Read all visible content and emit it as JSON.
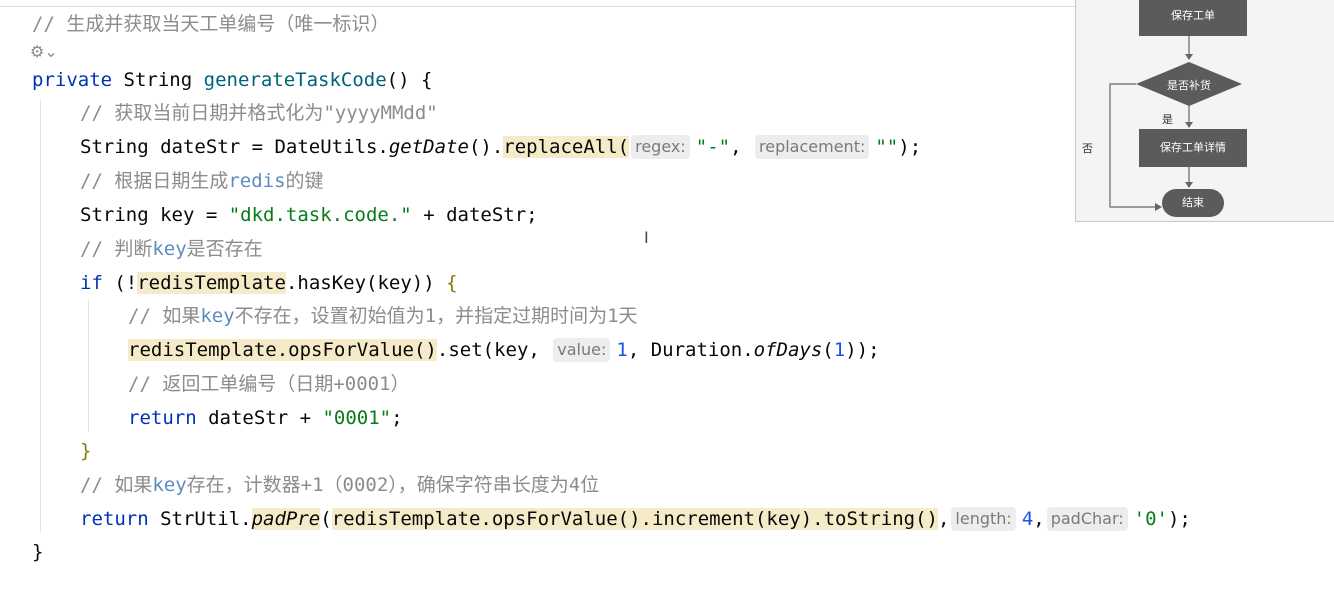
{
  "editor": {
    "comment_title": "// 生成并获取当天工单编号（唯一标识）",
    "gear_label": "⚙⌄",
    "sig": {
      "mod": "private",
      "type": "String",
      "name": "generateTaskCode",
      "rest": "() {"
    },
    "l1_comment": "// 获取当前日期并格式化为\"yyyyMMdd\"",
    "l2": {
      "a": "String dateStr = DateUtils.",
      "getDate": "getDate",
      "b": "().",
      "replaceAll": "replaceAll(",
      "hint_regex": "regex:",
      "s1": "\"-\"",
      "comma": ",",
      "hint_replacement": "replacement:",
      "s2": "\"\"",
      "end": ");"
    },
    "l3_comment_a": "// 根据日期生成",
    "l3_comment_kw": "redis",
    "l3_comment_b": "的键",
    "l4": {
      "a": "String key = ",
      "s": "\"dkd.task.code.\"",
      "b": " + dateStr;"
    },
    "l5_comment_a": "// 判断",
    "l5_comment_kw": "key",
    "l5_comment_b": "是否存在",
    "l6": {
      "if": "if",
      "a": " (!",
      "obj": "redisTemplate",
      "b": ".hasKey(key)",
      "c": ") ",
      "brace": "{"
    },
    "l7_comment_a": "// 如果",
    "l7_comment_kw": "key",
    "l7_comment_b": "不存在，设置初始值为1，并指定过期时间为1天",
    "l8": {
      "obj": "redisTemplate",
      "a": ".opsForValue()",
      "b": ".set(key, ",
      "hint_value": "value:",
      "num": "1",
      "c": ", Duration.",
      "ofDays": "ofDays",
      "d": "(",
      "num2": "1",
      "e": "));"
    },
    "l9_comment": "// 返回工单编号（日期+0001）",
    "l10": {
      "ret": "return",
      "a": " dateStr + ",
      "s": "\"0001\"",
      "b": ";"
    },
    "l11_brace": "}",
    "l12_comment_a": "// 如果",
    "l12_comment_kw": "key",
    "l12_comment_b": "存在，计数器+1（0002），确保字符串长度为4位",
    "l13": {
      "ret": "return",
      "a": " StrUtil.",
      "padPre": "padPre",
      "b": "(",
      "obj": "redisTemplate",
      "c": ".opsForValue().increment(key).toString()",
      "d": ",",
      "hint_length": "length:",
      "num": "4",
      "e": ",",
      "hint_padchar": "padChar:",
      "s": "'0'",
      "f": ");"
    },
    "l14_brace": "}"
  },
  "flowchart": {
    "save_order": "保存工单",
    "is_restock": "是否补货",
    "yes": "是",
    "no": "否",
    "save_detail": "保存工单详情",
    "end": "结束"
  }
}
